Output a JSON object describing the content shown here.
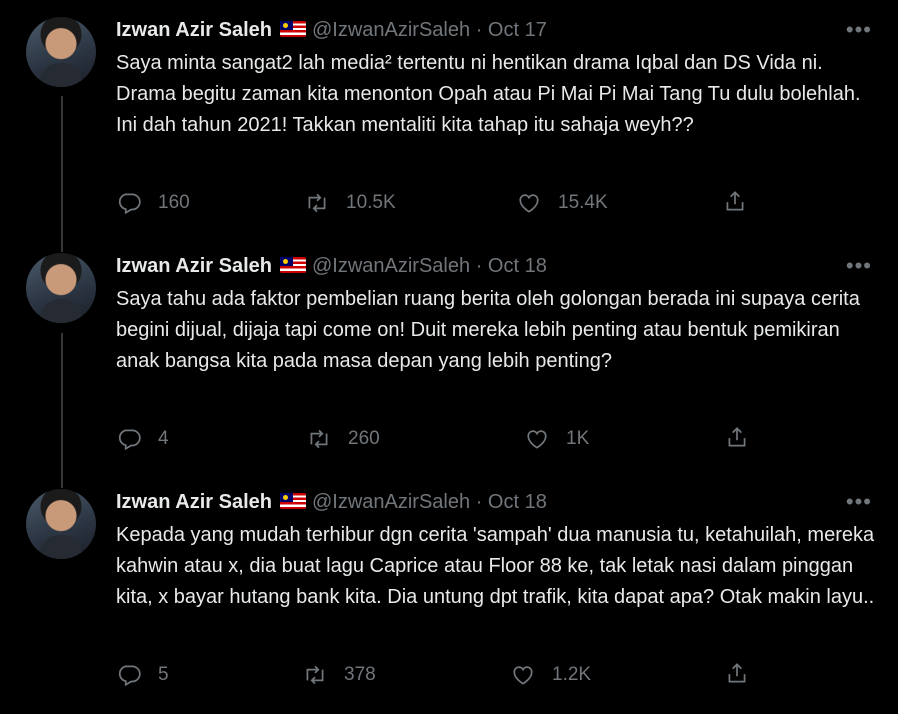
{
  "tweets": [
    {
      "name": "Izwan Azir Saleh",
      "handle": "@IzwanAzirSaleh",
      "dot": "·",
      "date": "Oct 17",
      "more": "•••",
      "text": "Saya minta sangat2 lah media² tertentu ni hentikan drama Iqbal dan DS Vida ni. Drama begitu zaman kita menonton Opah atau Pi Mai Pi Mai Tang Tu dulu bolehlah. Ini dah tahun 2021! Takkan mentaliti kita tahap itu sahaja weyh??",
      "replies": "160",
      "retweets": "10.5K",
      "likes": "15.4K"
    },
    {
      "name": "Izwan Azir Saleh",
      "handle": "@IzwanAzirSaleh",
      "dot": "·",
      "date": "Oct 18",
      "more": "•••",
      "text": "Saya tahu ada faktor pembelian ruang berita oleh golongan berada ini supaya cerita begini dijual, dijaja tapi come on! Duit mereka lebih penting atau bentuk pemikiran anak bangsa kita pada masa depan yang lebih penting?",
      "replies": "4",
      "retweets": "260",
      "likes": "1K"
    },
    {
      "name": "Izwan Azir Saleh",
      "handle": "@IzwanAzirSaleh",
      "dot": "·",
      "date": "Oct 18",
      "more": "•••",
      "text": "Kepada yang mudah terhibur dgn cerita 'sampah' dua manusia tu, ketahuilah, mereka kahwin atau x, dia buat lagu Caprice atau Floor 88 ke, tak letak nasi dalam pinggan kita, x bayar hutang bank kita. Dia untung dpt trafik, kita dapat apa? Otak makin layu..",
      "replies": "5",
      "retweets": "378",
      "likes": "1.2K"
    }
  ],
  "icons": {
    "reply": "reply-icon",
    "retweet": "retweet-icon",
    "like": "heart-icon",
    "share": "share-icon",
    "flag": "malaysia-flag-icon",
    "more": "more-icon"
  },
  "colors": {
    "background": "#000000",
    "text": "#e7e9ea",
    "muted": "#71767b",
    "thread_line": "#333639"
  }
}
